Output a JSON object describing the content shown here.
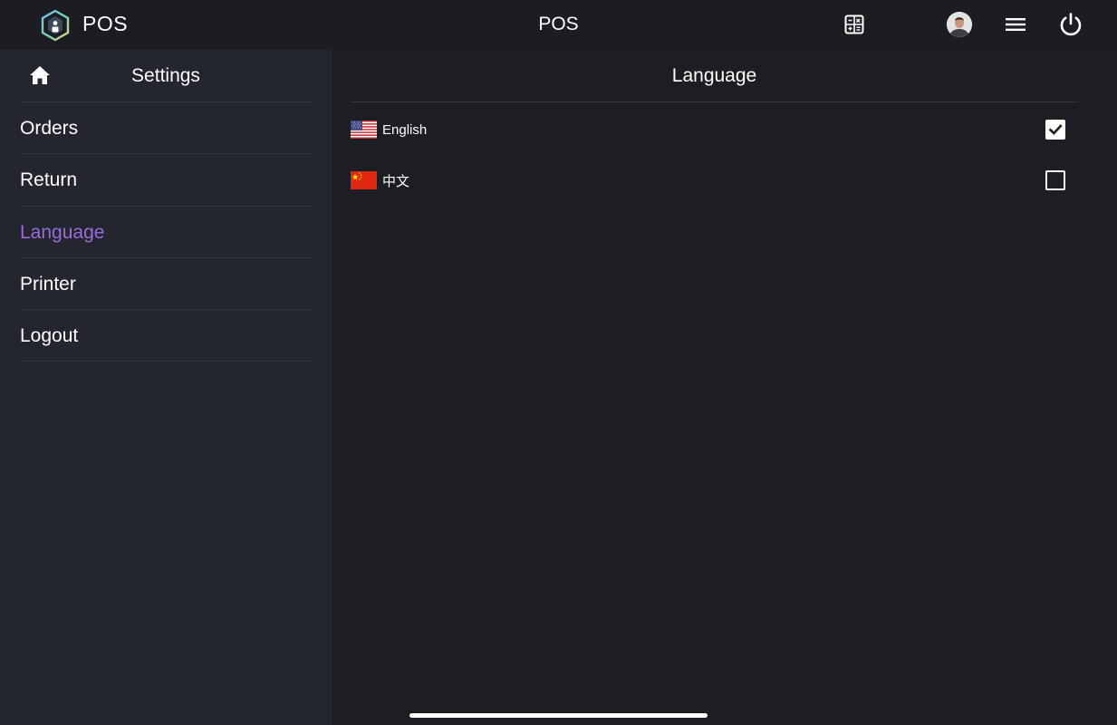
{
  "topbar": {
    "app_name": "POS",
    "title": "POS",
    "icons": [
      "hexagon-logo-icon",
      "calculator-icon",
      "avatar",
      "hamburger-menu-icon",
      "power-icon"
    ]
  },
  "sidebar": {
    "title": "Settings",
    "items": [
      {
        "label": "Orders"
      },
      {
        "label": "Return"
      },
      {
        "label": "Language",
        "active": true
      },
      {
        "label": "Printer"
      },
      {
        "label": "Logout"
      }
    ]
  },
  "main": {
    "title": "Language",
    "languages": [
      {
        "label": "English",
        "flag": "us-flag-icon",
        "checked": true
      },
      {
        "label": "中文",
        "flag": "china-flag-icon",
        "checked": false
      }
    ]
  },
  "colors": {
    "background": "#1d1e23",
    "topbar": "#1c1d22",
    "sidebar": "#23252f",
    "accent": "#9b6cd9",
    "divider": "#34363f"
  }
}
